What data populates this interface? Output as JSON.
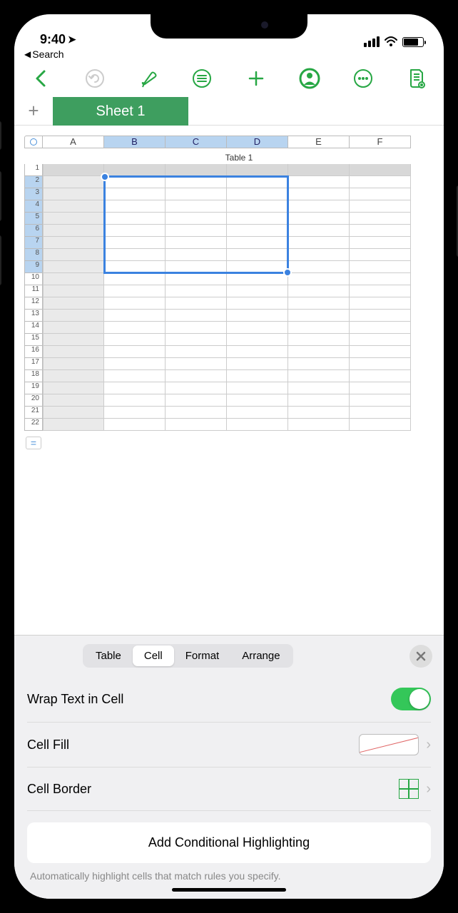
{
  "status": {
    "time": "9:40",
    "back_label": "Search"
  },
  "sheet": {
    "active_tab": "Sheet 1",
    "table_title": "Table 1",
    "columns": [
      "A",
      "B",
      "C",
      "D",
      "E",
      "F"
    ],
    "selected_columns": [
      "B",
      "C",
      "D"
    ],
    "row_count": 22,
    "selected_rows_start": 2,
    "selected_rows_end": 9
  },
  "inspector": {
    "tabs": [
      "Table",
      "Cell",
      "Format",
      "Arrange"
    ],
    "active_tab": "Cell",
    "wrap_text_label": "Wrap Text in Cell",
    "wrap_text_on": true,
    "cell_fill_label": "Cell Fill",
    "cell_border_label": "Cell Border",
    "cond_highlight_button": "Add Conditional Highlighting",
    "cond_highlight_hint": "Automatically highlight cells that match rules you specify."
  }
}
